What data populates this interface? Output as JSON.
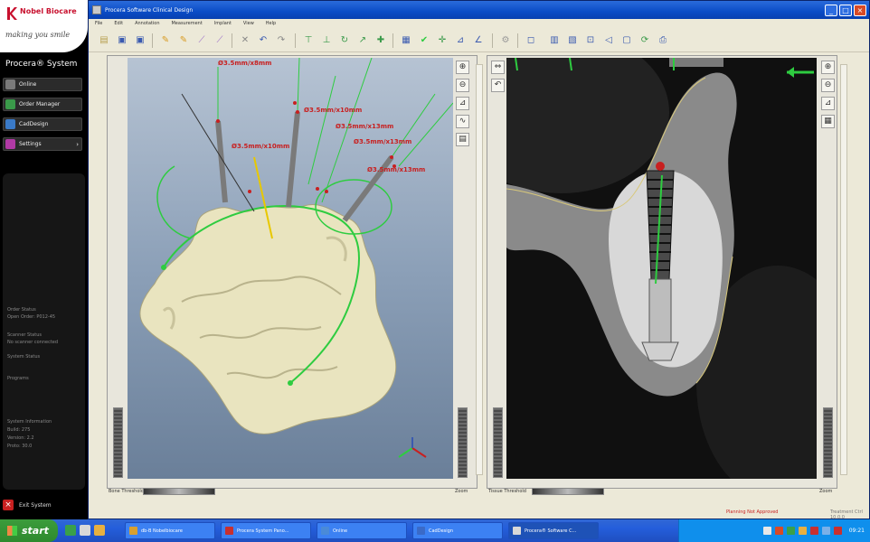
{
  "sidebar": {
    "brand": "Nobel Biocare",
    "tagline": "making you smile",
    "system_title": "Procera® System",
    "nav": [
      {
        "label": "Online",
        "icon": "globe-icon",
        "color": "#7a7a7a"
      },
      {
        "label": "Order Manager",
        "icon": "order-manager-icon",
        "color": "#3a9a4a"
      },
      {
        "label": "CadDesign",
        "icon": "caddesign-icon",
        "color": "#3a7ac8"
      },
      {
        "label": "Settings",
        "icon": "settings-icon",
        "color": "#b23aa6",
        "chevron": "›"
      }
    ],
    "info": [
      "Order Status",
      "Open Order: P012-45",
      "Scanner Status",
      "No scanner connected",
      "System Status",
      "Programs",
      "System Information",
      "Build: 275",
      "Version: 2.2",
      "Proto: 30.0"
    ],
    "exit_label": "Exit System"
  },
  "window": {
    "title": "Procera Software Clinical Design",
    "menu": [
      "File",
      "Edit",
      "Annotation",
      "Measurement",
      "Implant",
      "View",
      "Help"
    ],
    "controls": {
      "minimize": "_",
      "maximize": "□",
      "close": "×"
    }
  },
  "view3d": {
    "annotations": [
      "Ø3.5mm/x8mm",
      "Ø3.5mm/x10mm",
      "Ø3.5mm/x13mm",
      "Ø3.5mm/x13mm",
      "Ø3.5mm/x10mm",
      "Ø3.5mm/x13mm"
    ],
    "bottom_left_label": "Bone Threshold",
    "bottom_right_label": "Zoom"
  },
  "view2d": {
    "bottom_left_label": "Tissue Threshold",
    "bottom_right_label": "Zoom"
  },
  "status": {
    "warning": "Planning Not Approved",
    "version": "Treatment Ctrl 10.0.0"
  },
  "taskbar": {
    "start_label": "start",
    "tasks": [
      {
        "label": "db-B Nobelbiocare",
        "color": "#d8a030"
      },
      {
        "label": "Procera System Pano...",
        "color": "#c83030"
      },
      {
        "label": "Online",
        "color": "#4a8ad8"
      },
      {
        "label": "CadDesign",
        "color": "#3a6ac8"
      },
      {
        "label": "Procera® Software C...",
        "color": "#d8d8d8",
        "active": true
      }
    ],
    "clock": "09:21"
  },
  "colors": {
    "accent_green": "#2ecc40",
    "annotation_red": "#c82020",
    "bone": "#e9e4bf"
  }
}
